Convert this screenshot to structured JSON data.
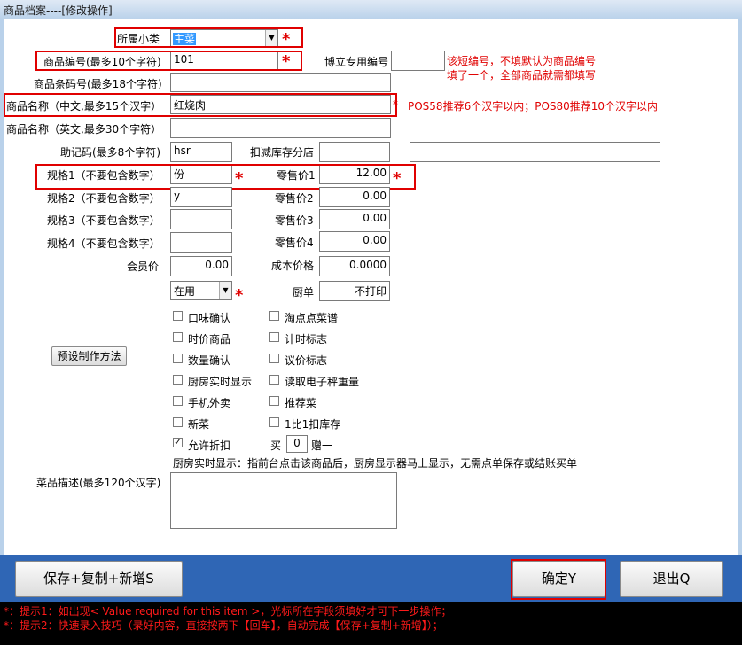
{
  "window": {
    "title": "商品档案----[修改操作]"
  },
  "form": {
    "subcategory_label": "所属小类",
    "subcategory_value": "主菜",
    "code_label": "商品编号(最多10个字符)",
    "code_value": "101",
    "boli_code_label": "博立专用编号",
    "boli_code_value": "",
    "boli_note_1": "该短编号，不填默认为商品编号",
    "boli_note_2": "填了一个，全部商品就需都填写",
    "barcode_label": "商品条码号(最多18个字符)",
    "barcode_value": "",
    "name_cn_label": "商品名称（中文,最多15个汉字）",
    "name_cn_value": "红烧肉",
    "name_note": "POS58推荐6个汉字以内；POS80推荐10个汉字以内",
    "name_en_label": "商品名称（英文,最多30个字符）",
    "name_en_value": "",
    "mnemonic_label": "助记码(最多8个字符)",
    "mnemonic_value": "hsr",
    "stock_branch_label": "扣减库存分店",
    "stock_branch_value": "",
    "stock_branch_extra": "",
    "spec1_label": "规格1（不要包含数字）",
    "spec1_value": "份",
    "spec2_label": "规格2（不要包含数字）",
    "spec2_value": "y",
    "spec3_label": "规格3（不要包含数字）",
    "spec3_value": "",
    "spec4_label": "规格4（不要包含数字）",
    "spec4_value": "",
    "price1_label": "零售价1",
    "price1_value": "12.00",
    "price2_label": "零售价2",
    "price2_value": "0.00",
    "price3_label": "零售价3",
    "price3_value": "0.00",
    "price4_label": "零售价4",
    "price4_value": "0.00",
    "member_price_label": "会员价",
    "member_price_value": "0.00",
    "cost_price_label": "成本价格",
    "cost_price_value": "0.0000",
    "status_value": "在用",
    "kitchen_label": "厨单",
    "kitchen_value": "不打印",
    "preset_button": "预设制作方法",
    "checkboxes_left": [
      {
        "label": "口味确认",
        "checked": false
      },
      {
        "label": "时价商品",
        "checked": false
      },
      {
        "label": "数量确认",
        "checked": false
      },
      {
        "label": "厨房实时显示",
        "checked": false
      },
      {
        "label": "手机外卖",
        "checked": false
      },
      {
        "label": "新菜",
        "checked": false
      },
      {
        "label": "允许折扣",
        "checked": true
      }
    ],
    "checkboxes_right": [
      {
        "label": "淘点点菜谱",
        "checked": false
      },
      {
        "label": "计时标志",
        "checked": false
      },
      {
        "label": "议价标志",
        "checked": false
      },
      {
        "label": "读取电子秤重量",
        "checked": false
      },
      {
        "label": "推荐菜",
        "checked": false
      },
      {
        "label": "1比1扣库存",
        "checked": false
      }
    ],
    "buy_label": "买",
    "buy_value": "0",
    "gift_label": "赠一",
    "kitchen_note": "厨房实时显示：指前台点击该商品后，厨房显示器马上显示，无需点单保存或结账买单",
    "desc_label": "菜品描述(最多120个汉字)",
    "desc_value": "",
    "star": "*"
  },
  "buttons": {
    "save_copy_new": "保存+复制+新增S",
    "confirm": "确定Y",
    "exit": "退出Q"
  },
  "hints": {
    "line1": "*：提示1：如出现< Value required for this item >，光标所在字段须填好才可下一步操作；",
    "line2": "*：提示2：快速录入技巧（录好内容，直接按两下【回车】，自动完成【保存+复制+新增】）；"
  },
  "colors": {
    "highlight_red": "#e00000",
    "bottom_bar": "#2f66b5",
    "hint_bg": "#000000"
  }
}
